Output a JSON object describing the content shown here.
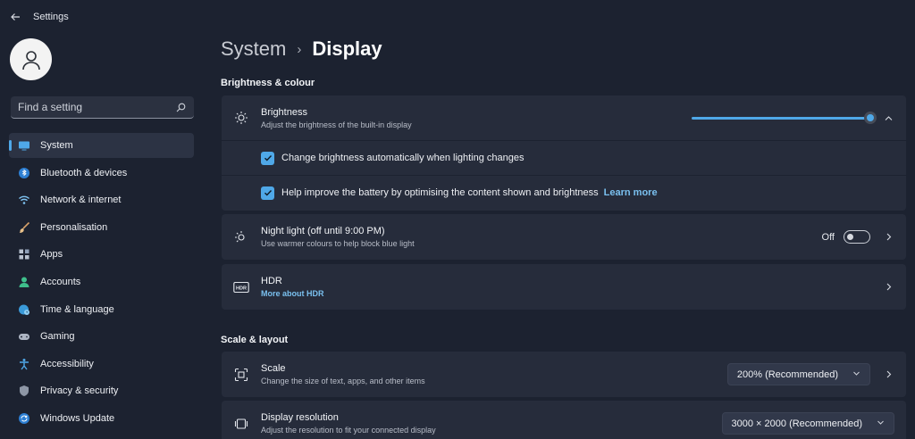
{
  "app": {
    "title": "Settings"
  },
  "search": {
    "placeholder": "Find a setting"
  },
  "sidebar": {
    "items": [
      {
        "label": "System",
        "icon": "monitor-icon"
      },
      {
        "label": "Bluetooth & devices",
        "icon": "bluetooth-icon"
      },
      {
        "label": "Network & internet",
        "icon": "wifi-icon"
      },
      {
        "label": "Personalisation",
        "icon": "brush-icon"
      },
      {
        "label": "Apps",
        "icon": "apps-grid-icon"
      },
      {
        "label": "Accounts",
        "icon": "person-icon"
      },
      {
        "label": "Time & language",
        "icon": "globe-clock-icon"
      },
      {
        "label": "Gaming",
        "icon": "gamepad-icon"
      },
      {
        "label": "Accessibility",
        "icon": "accessibility-icon"
      },
      {
        "label": "Privacy & security",
        "icon": "shield-icon"
      },
      {
        "label": "Windows Update",
        "icon": "update-icon"
      }
    ]
  },
  "breadcrumb": {
    "parent": "System",
    "separator": "›",
    "current": "Display"
  },
  "sections": {
    "brightness_title": "Brightness & colour",
    "scale_title": "Scale & layout"
  },
  "brightness": {
    "title": "Brightness",
    "description": "Adjust the brightness of the built-in display",
    "level": 1.0,
    "auto_label": "Change brightness automatically when lighting changes",
    "battery_label": "Help improve the battery by optimising the content shown and brightness",
    "learn_more": "Learn more"
  },
  "night_light": {
    "title": "Night light (off until 9:00 PM)",
    "description": "Use warmer colours to help block blue light",
    "state": "Off"
  },
  "hdr": {
    "title": "HDR",
    "link": "More about HDR"
  },
  "scale": {
    "title": "Scale",
    "description": "Change the size of text, apps, and other items",
    "value": "200% (Recommended)"
  },
  "resolution": {
    "title": "Display resolution",
    "description": "Adjust the resolution to fit your connected display",
    "value": "3000 × 2000 (Recommended)"
  },
  "colors": {
    "accent": "#4fa8e8",
    "background": "#1c2230",
    "card": "#262c3b"
  }
}
